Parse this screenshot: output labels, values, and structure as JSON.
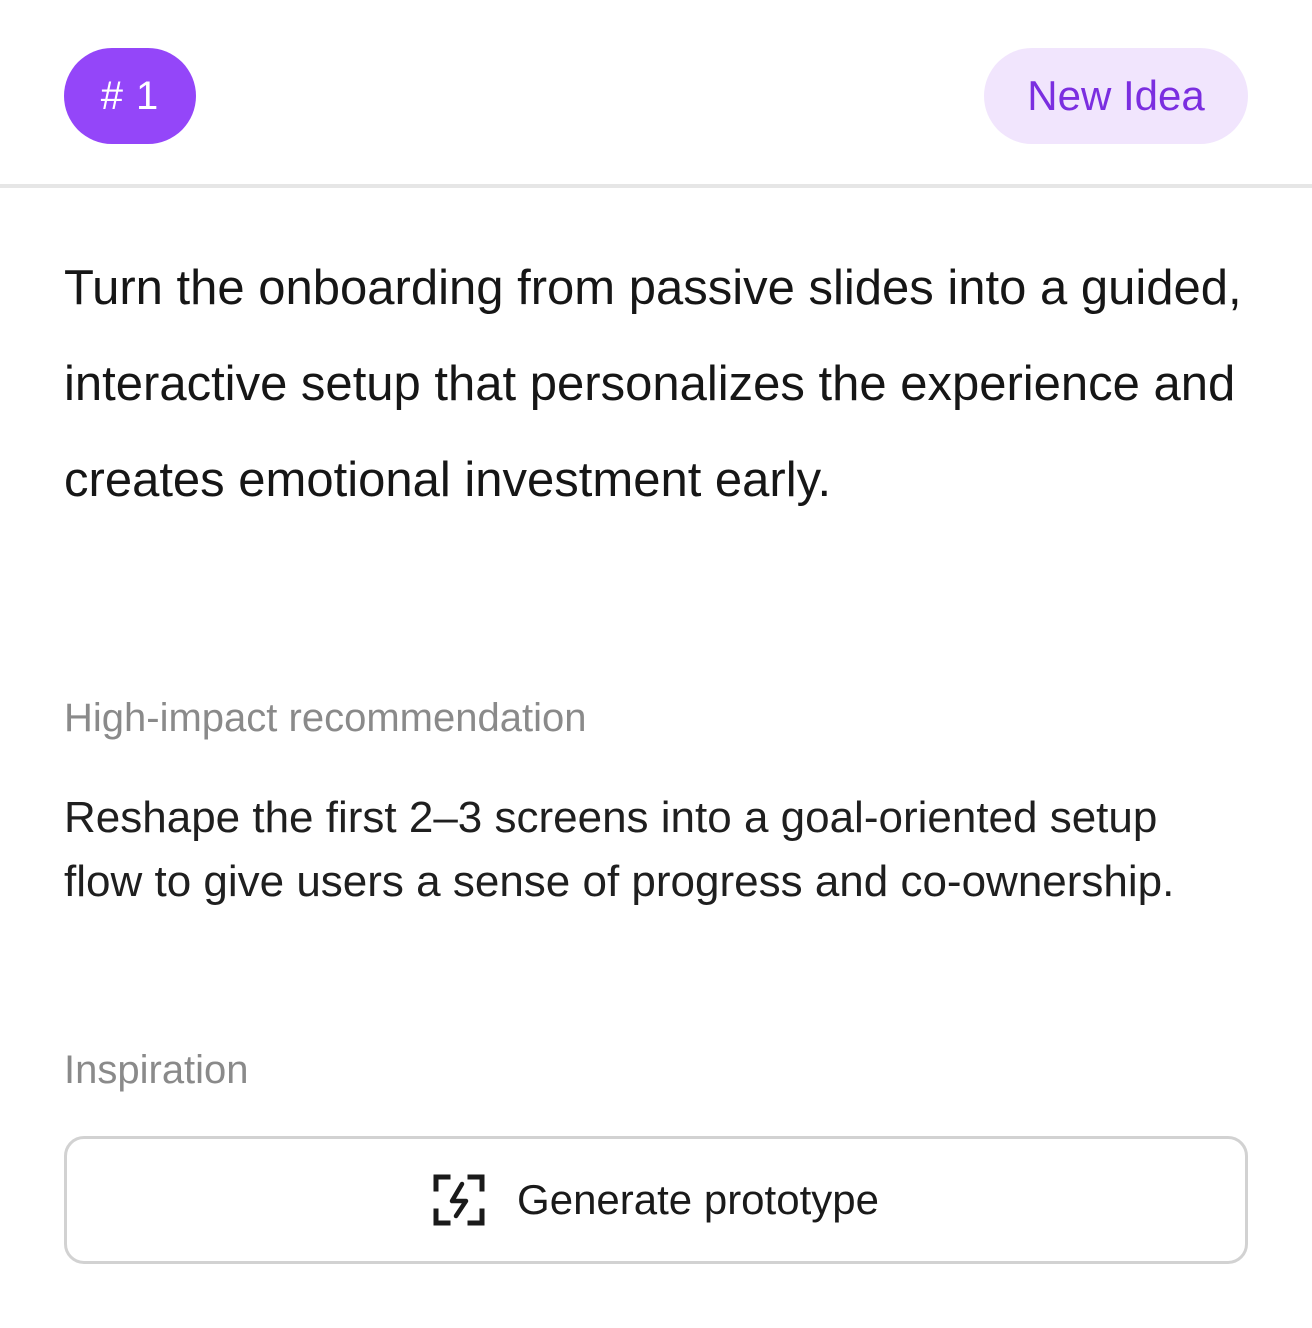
{
  "header": {
    "rank_label": "# 1",
    "status_label": "New Idea"
  },
  "idea": {
    "title": "Turn the onboarding from passive slides into a guided, interactive setup that personalizes the experience and creates emotional investment early."
  },
  "recommendation": {
    "label": "High-impact recommendation",
    "text": "Reshape the first 2–3 screens into a goal-oriented setup flow to give users a sense of progress and co-ownership."
  },
  "inspiration": {
    "label": "Inspiration",
    "button_label": "Generate prototype",
    "button_icon": "bolt-frame-icon"
  },
  "colors": {
    "accent": "#9446f9",
    "status_bg": "#f1e5fd",
    "status_text": "#7b2ee0"
  }
}
